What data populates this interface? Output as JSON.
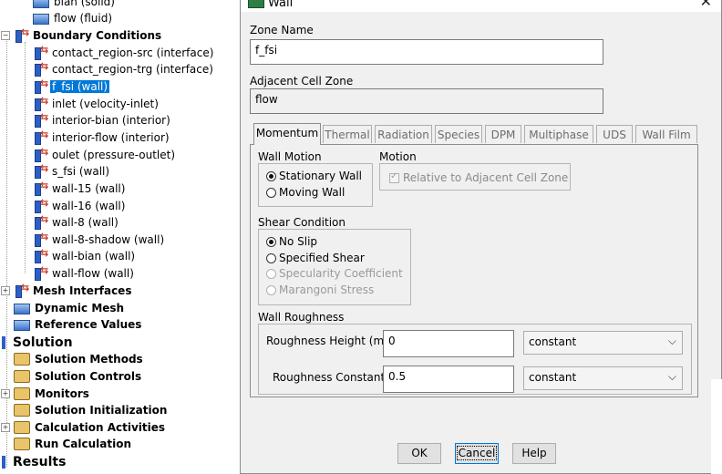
{
  "tree": {
    "items": [
      {
        "label": "bian (solid)",
        "icon": "cell-zone-icon"
      },
      {
        "label": "flow (fluid)",
        "icon": "cell-zone-icon"
      },
      {
        "label": "Boundary Conditions",
        "icon": "boundary-conditions-icon"
      },
      {
        "label": "contact_region-src (interface)",
        "icon": "boundary-icon"
      },
      {
        "label": "contact_region-trg (interface)",
        "icon": "boundary-icon"
      },
      {
        "label": "f_fsi (wall)",
        "icon": "boundary-icon"
      },
      {
        "label": "inlet (velocity-inlet)",
        "icon": "boundary-icon"
      },
      {
        "label": "interior-bian (interior)",
        "icon": "boundary-icon"
      },
      {
        "label": "interior-flow (interior)",
        "icon": "boundary-icon"
      },
      {
        "label": "oulet (pressure-outlet)",
        "icon": "boundary-icon"
      },
      {
        "label": "s_fsi (wall)",
        "icon": "boundary-icon"
      },
      {
        "label": "wall-15 (wall)",
        "icon": "boundary-icon"
      },
      {
        "label": "wall-16 (wall)",
        "icon": "boundary-icon"
      },
      {
        "label": "wall-8 (wall)",
        "icon": "boundary-icon"
      },
      {
        "label": "wall-8-shadow (wall)",
        "icon": "boundary-icon"
      },
      {
        "label": "wall-bian (wall)",
        "icon": "boundary-icon"
      },
      {
        "label": "wall-flow (wall)",
        "icon": "boundary-icon"
      },
      {
        "label": "Mesh Interfaces",
        "icon": "mesh-interfaces-icon"
      },
      {
        "label": "Dynamic Mesh",
        "icon": "dynamic-mesh-icon"
      },
      {
        "label": "Reference Values",
        "icon": "reference-values-icon"
      },
      {
        "label": "Solution",
        "icon": "solution-icon"
      },
      {
        "label": "Solution Methods",
        "icon": "solution-methods-icon"
      },
      {
        "label": "Solution Controls",
        "icon": "solution-controls-icon"
      },
      {
        "label": "Monitors",
        "icon": "monitors-icon"
      },
      {
        "label": "Solution Initialization",
        "icon": "solution-initialization-icon"
      },
      {
        "label": "Calculation Activities",
        "icon": "calculation-activities-icon"
      },
      {
        "label": "Run Calculation",
        "icon": "run-calculation-icon"
      },
      {
        "label": "Results",
        "icon": "results-icon"
      }
    ],
    "selected": "f_fsi (wall)"
  },
  "dialog": {
    "title": "Wall",
    "zone_name_label": "Zone Name",
    "zone_name_value": "f_fsi",
    "adjacent_label": "Adjacent Cell Zone",
    "adjacent_value": "flow",
    "tabs": [
      "Momentum",
      "Thermal",
      "Radiation",
      "Species",
      "DPM",
      "Multiphase",
      "UDS",
      "Wall Film"
    ],
    "active_tab": "Momentum",
    "wall_motion": {
      "title": "Wall Motion",
      "options": [
        "Stationary Wall",
        "Moving Wall"
      ],
      "selected": "Stationary Wall"
    },
    "motion": {
      "title": "Motion",
      "relative_label": "Relative to Adjacent Cell Zone",
      "relative_checked": true
    },
    "shear": {
      "title": "Shear Condition",
      "options": [
        "No Slip",
        "Specified Shear",
        "Specularity Coefficient",
        "Marangoni Stress"
      ],
      "selected": "No Slip"
    },
    "roughness": {
      "title": "Wall Roughness",
      "height_label": "Roughness Height (m)",
      "height_value": "0",
      "height_method": "constant",
      "constant_label": "Roughness Constant",
      "constant_value": "0.5",
      "constant_method": "constant"
    },
    "buttons": {
      "ok": "OK",
      "cancel": "Cancel",
      "help": "Help"
    }
  }
}
